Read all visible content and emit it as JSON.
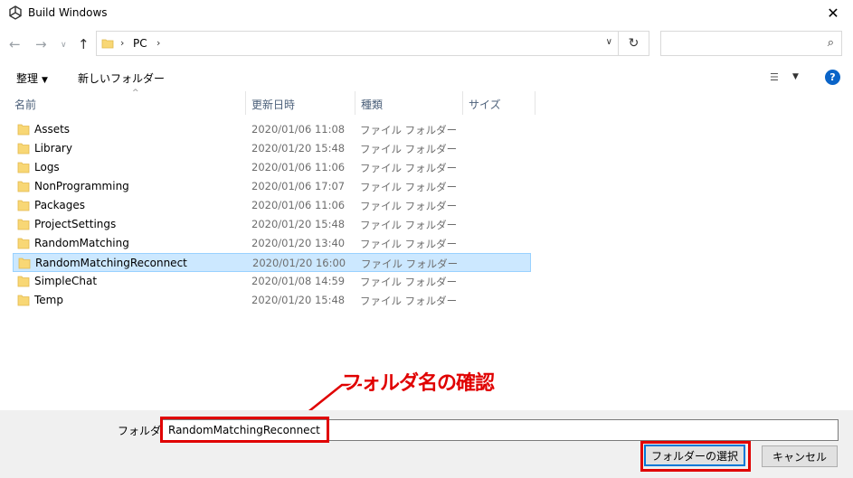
{
  "window": {
    "title": "Build Windows"
  },
  "nav": {
    "breadcrumb": [
      "PC"
    ],
    "search_placeholder": ""
  },
  "toolbar": {
    "organize_label": "整理",
    "new_folder_label": "新しいフォルダー"
  },
  "columns": {
    "name": "名前",
    "date": "更新日時",
    "type": "種類",
    "size": "サイズ"
  },
  "files": [
    {
      "name": "Assets",
      "date": "2020/01/06 11:08",
      "type": "ファイル フォルダー"
    },
    {
      "name": "Library",
      "date": "2020/01/20 15:48",
      "type": "ファイル フォルダー"
    },
    {
      "name": "Logs",
      "date": "2020/01/06 11:06",
      "type": "ファイル フォルダー"
    },
    {
      "name": "NonProgramming",
      "date": "2020/01/06 17:07",
      "type": "ファイル フォルダー"
    },
    {
      "name": "Packages",
      "date": "2020/01/06 11:06",
      "type": "ファイル フォルダー"
    },
    {
      "name": "ProjectSettings",
      "date": "2020/01/20 15:48",
      "type": "ファイル フォルダー"
    },
    {
      "name": "RandomMatching",
      "date": "2020/01/20 13:40",
      "type": "ファイル フォルダー"
    },
    {
      "name": "RandomMatchingReconnect",
      "date": "2020/01/20 16:00",
      "type": "ファイル フォルダー"
    },
    {
      "name": "SimpleChat",
      "date": "2020/01/08 14:59",
      "type": "ファイル フォルダー"
    },
    {
      "name": "Temp",
      "date": "2020/01/20 15:48",
      "type": "ファイル フォルダー"
    }
  ],
  "selected_index": 7,
  "bottom": {
    "folder_label": "フォルダー:",
    "folder_value": "RandomMatchingReconnect",
    "select_button": "フォルダーの選択",
    "cancel_button": "キャンセル"
  },
  "annotation": {
    "text": "フォルダ名の確認"
  },
  "colors": {
    "highlight": "#e00000",
    "selection": "#cce8ff",
    "folder": "#f8d775",
    "accent": "#0078d7"
  }
}
